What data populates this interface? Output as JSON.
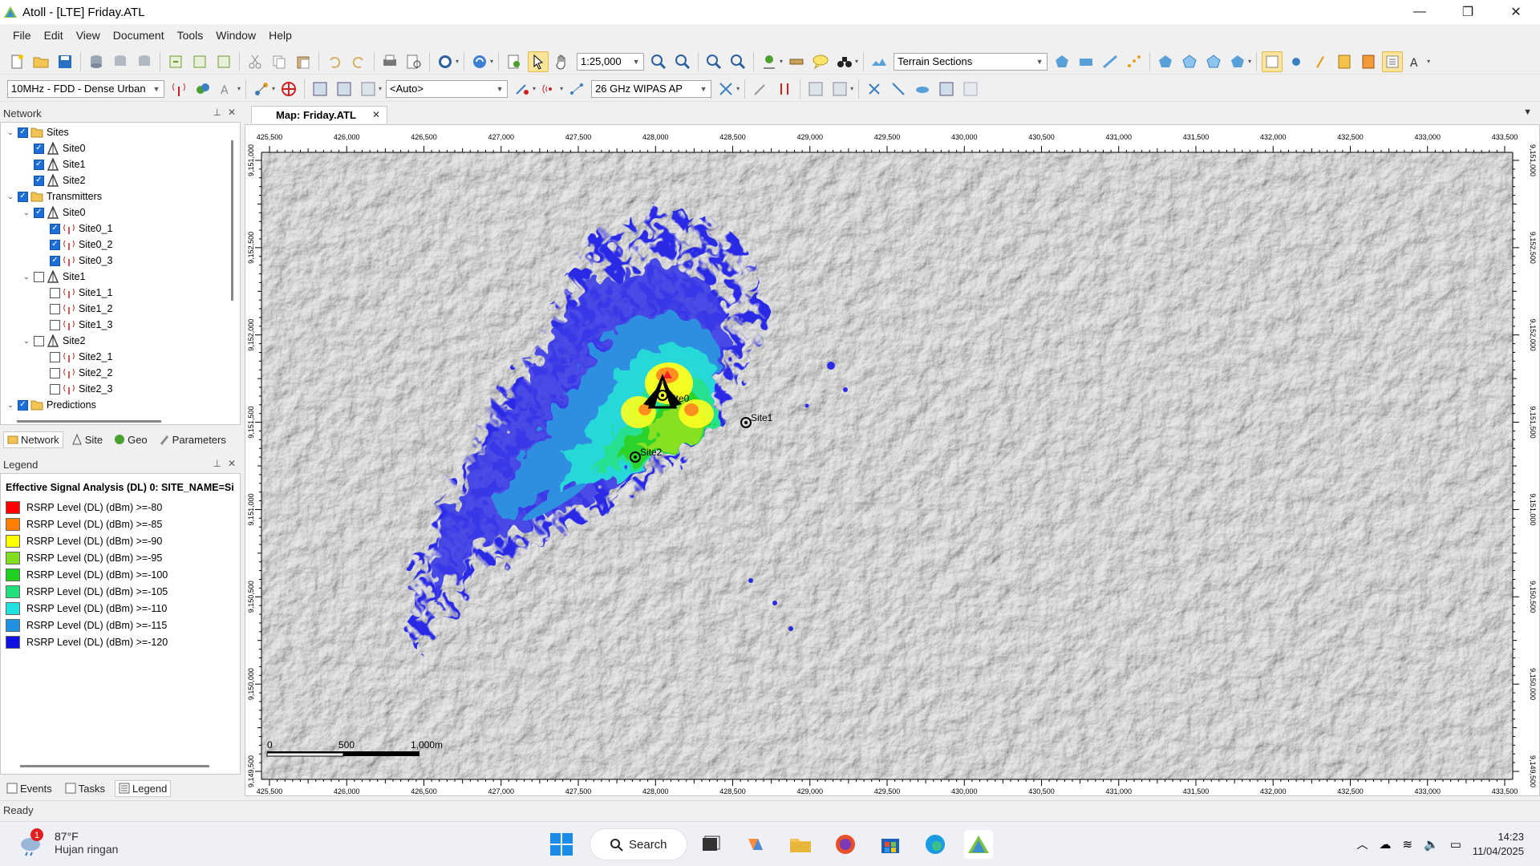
{
  "window": {
    "title": "Atoll - [LTE] Friday.ATL",
    "minimize": "—",
    "maximize": "❐",
    "close": "✕"
  },
  "menu": [
    "File",
    "Edit",
    "View",
    "Document",
    "Tools",
    "Window",
    "Help"
  ],
  "toolbar1": {
    "zoom_scale": "1:25,000",
    "terrain_combo": "Terrain Sections"
  },
  "toolbar2": {
    "band_combo": "10MHz - FDD - Dense Urban",
    "auto_combo": "<Auto>",
    "ap_combo": "26 GHz WIPAS AP"
  },
  "network_panel": {
    "title": "Network",
    "tree": [
      {
        "label": "Sites",
        "level": 0,
        "twisty": "v",
        "checked": true,
        "icon": "folder-icon"
      },
      {
        "label": "Site0",
        "level": 1,
        "twisty": "",
        "checked": true,
        "icon": "site-icon"
      },
      {
        "label": "Site1",
        "level": 1,
        "twisty": "",
        "checked": true,
        "icon": "site-icon"
      },
      {
        "label": "Site2",
        "level": 1,
        "twisty": "",
        "checked": true,
        "icon": "site-icon"
      },
      {
        "label": "Transmitters",
        "level": 0,
        "twisty": "v",
        "checked": true,
        "icon": "folder-icon"
      },
      {
        "label": "Site0",
        "level": 1,
        "twisty": "v",
        "checked": true,
        "icon": "site-icon"
      },
      {
        "label": "Site0_1",
        "level": 2,
        "twisty": "",
        "checked": true,
        "icon": "transmitter-icon"
      },
      {
        "label": "Site0_2",
        "level": 2,
        "twisty": "",
        "checked": true,
        "icon": "transmitter-icon"
      },
      {
        "label": "Site0_3",
        "level": 2,
        "twisty": "",
        "checked": true,
        "icon": "transmitter-icon"
      },
      {
        "label": "Site1",
        "level": 1,
        "twisty": "v",
        "checked": false,
        "icon": "site-icon"
      },
      {
        "label": "Site1_1",
        "level": 2,
        "twisty": "",
        "checked": false,
        "icon": "transmitter-icon"
      },
      {
        "label": "Site1_2",
        "level": 2,
        "twisty": "",
        "checked": false,
        "icon": "transmitter-icon"
      },
      {
        "label": "Site1_3",
        "level": 2,
        "twisty": "",
        "checked": false,
        "icon": "transmitter-icon"
      },
      {
        "label": "Site2",
        "level": 1,
        "twisty": "v",
        "checked": false,
        "icon": "site-icon"
      },
      {
        "label": "Site2_1",
        "level": 2,
        "twisty": "",
        "checked": false,
        "icon": "transmitter-icon"
      },
      {
        "label": "Site2_2",
        "level": 2,
        "twisty": "",
        "checked": false,
        "icon": "transmitter-icon"
      },
      {
        "label": "Site2_3",
        "level": 2,
        "twisty": "",
        "checked": false,
        "icon": "transmitter-icon"
      },
      {
        "label": "Predictions",
        "level": 0,
        "twisty": "v",
        "checked": true,
        "icon": "folder-icon"
      }
    ],
    "tabs": [
      "Network",
      "Site",
      "Geo",
      "Parameters"
    ]
  },
  "legend_panel": {
    "title": "Legend",
    "heading": "Effective Signal Analysis (DL) 0: SITE_NAME=Si",
    "items": [
      {
        "label": "RSRP Level (DL) (dBm) >=-80",
        "color": "#ff0000"
      },
      {
        "label": "RSRP Level (DL) (dBm) >=-85",
        "color": "#ff8000"
      },
      {
        "label": "RSRP Level (DL) (dBm) >=-90",
        "color": "#ffff00"
      },
      {
        "label": "RSRP Level (DL) (dBm) >=-95",
        "color": "#80e020"
      },
      {
        "label": "RSRP Level (DL) (dBm) >=-100",
        "color": "#20d020"
      },
      {
        "label": "RSRP Level (DL) (dBm) >=-105",
        "color": "#20e080"
      },
      {
        "label": "RSRP Level (DL) (dBm) >=-110",
        "color": "#20e0e0"
      },
      {
        "label": "RSRP Level (DL) (dBm) >=-115",
        "color": "#2090e0"
      },
      {
        "label": "RSRP Level (DL) (dBm) >=-120",
        "color": "#1010e0"
      }
    ],
    "bottom_tabs": [
      "Events",
      "Tasks",
      "Legend"
    ]
  },
  "map": {
    "tab_label": "Map: Friday.ATL",
    "x_ticks": [
      "425,500",
      "426,000",
      "426,500",
      "427,000",
      "427,500",
      "428,000",
      "428,500",
      "429,000",
      "429,500",
      "430,000",
      "430,500",
      "431,000",
      "431,500",
      "432,000",
      "432,500",
      "433,000",
      "433,500"
    ],
    "y_ticks": [
      "9,151,000",
      "9,152,500",
      "9,152,000",
      "9,151,500",
      "9,151,000",
      "9,150,500",
      "9,150,000",
      "9,149,500"
    ],
    "sites": [
      {
        "name": "Site0"
      },
      {
        "name": "Site1"
      },
      {
        "name": "Site2"
      }
    ],
    "scale_labels": [
      "0",
      "500",
      "1,000m"
    ]
  },
  "status": {
    "text": "Ready"
  },
  "taskbar": {
    "weather_temp": "87°F",
    "weather_desc": "Hujan ringan",
    "weather_badge": "1",
    "search_label": "Search",
    "time": "14:23",
    "date": "11/04/2025"
  }
}
